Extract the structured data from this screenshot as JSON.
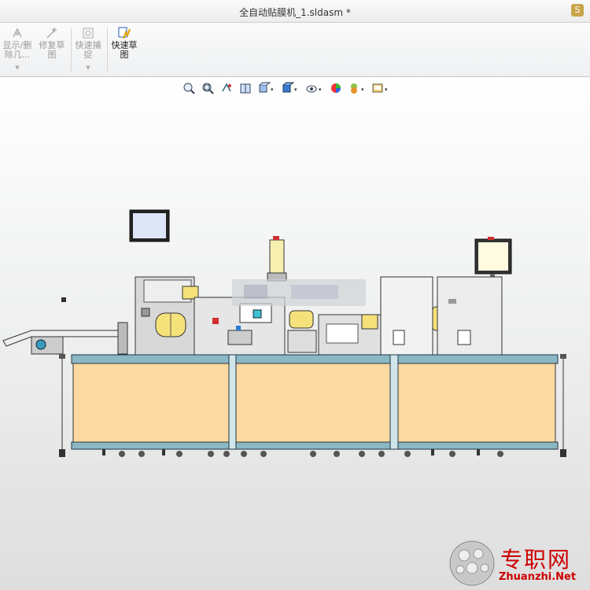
{
  "window": {
    "title": "全自动贴膜机_1.sldasm *"
  },
  "ribbon": {
    "buttons": [
      {
        "line1": "显示/删",
        "line2": "除几...",
        "icon": "display-delete-relations-icon",
        "enabled": false
      },
      {
        "line1": "修复草",
        "line2": "图",
        "icon": "repair-sketch-icon",
        "enabled": false
      },
      {
        "line1": "快速捕",
        "line2": "捉",
        "icon": "quick-snaps-icon",
        "enabled": false
      },
      {
        "line1": "快速草",
        "line2": "图",
        "icon": "rapid-sketch-icon",
        "enabled": true
      }
    ]
  },
  "heads_up_toolbar": {
    "icons": [
      "zoom-to-fit-icon",
      "zoom-to-area-icon",
      "previous-view-icon",
      "section-view-icon",
      "view-orientation-icon",
      "display-style-icon",
      "hide-show-items-icon",
      "edit-appearance-icon",
      "apply-scene-icon",
      "view-settings-icon"
    ]
  },
  "watermark": {
    "text": "专职网",
    "url": "Zhuanzhi.Net"
  },
  "colors": {
    "panel_fill": "#fcd9a0",
    "rail": "#8ab8c4",
    "screen": "#dde6f7",
    "accent_red": "#d03030"
  }
}
